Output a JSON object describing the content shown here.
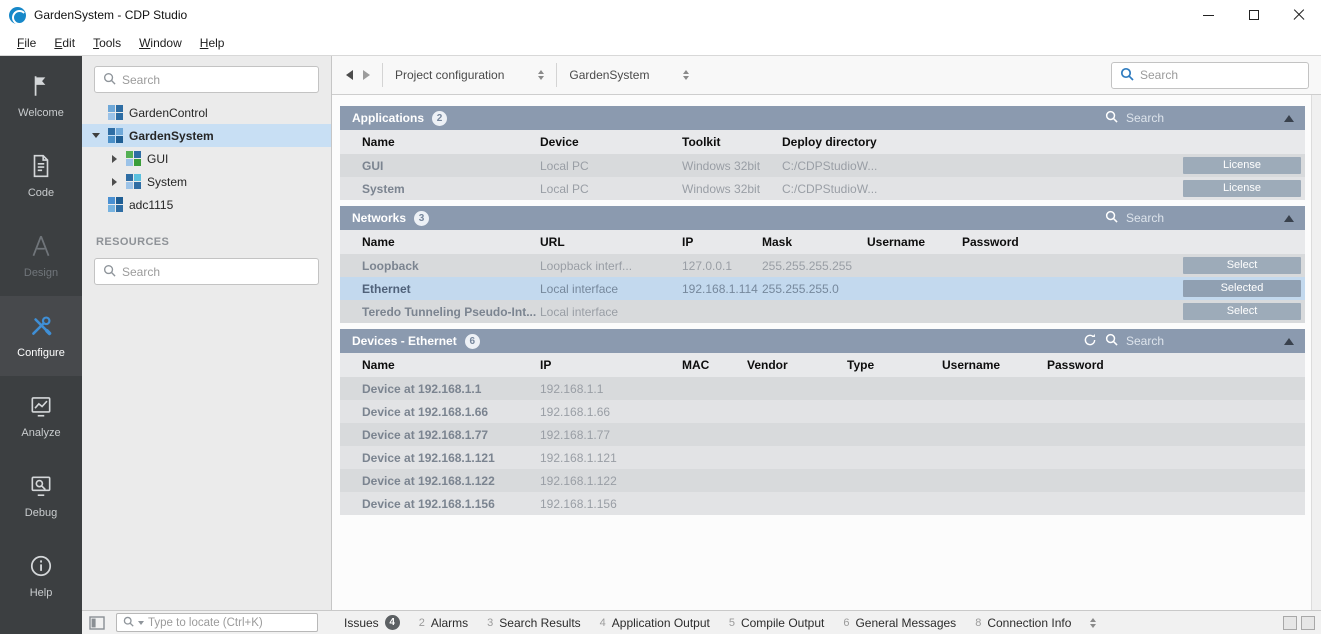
{
  "window": {
    "title": "GardenSystem - CDP Studio"
  },
  "menubar": {
    "items": [
      "File",
      "Edit",
      "Tools",
      "Window",
      "Help"
    ]
  },
  "modebar": {
    "items": [
      {
        "label": "Welcome"
      },
      {
        "label": "Code"
      },
      {
        "label": "Design"
      },
      {
        "label": "Configure"
      },
      {
        "label": "Analyze"
      },
      {
        "label": "Debug"
      },
      {
        "label": "Help"
      }
    ]
  },
  "project_panel": {
    "search_placeholder": "Search",
    "tree": [
      {
        "label": "GardenControl"
      },
      {
        "label": "GardenSystem"
      },
      {
        "label": "GUI"
      },
      {
        "label": "System"
      },
      {
        "label": "adc1115"
      }
    ],
    "resources_label": "RESOURCES",
    "resources_search_placeholder": "Search"
  },
  "toolbar": {
    "breadcrumb": [
      "Project configuration",
      "GardenSystem"
    ],
    "search_placeholder": "Search"
  },
  "sections": {
    "applications": {
      "title": "Applications",
      "count": "2",
      "search_label": "Search",
      "columns": [
        "Name",
        "Device",
        "Toolkit",
        "Deploy directory"
      ],
      "rows": [
        {
          "name": "GUI",
          "device": "Local PC",
          "toolkit": "Windows 32bit",
          "deploy": "C:/CDPStudioW...",
          "action": "License"
        },
        {
          "name": "System",
          "device": "Local PC",
          "toolkit": "Windows 32bit",
          "deploy": "C:/CDPStudioW...",
          "action": "License"
        }
      ]
    },
    "networks": {
      "title": "Networks",
      "count": "3",
      "search_label": "Search",
      "columns": [
        "Name",
        "URL",
        "IP",
        "Mask",
        "Username",
        "Password"
      ],
      "rows": [
        {
          "name": "Loopback",
          "url": "Loopback interf...",
          "ip": "127.0.0.1",
          "mask": "255.255.255.255",
          "username": "",
          "password": "",
          "action": "Select"
        },
        {
          "name": "Ethernet",
          "url": "Local interface",
          "ip": "192.168.1.114",
          "mask": "255.255.255.0",
          "username": "",
          "password": "",
          "action": "Selected"
        },
        {
          "name": "Teredo Tunneling Pseudo-Int...",
          "url": "Local interface",
          "ip": "",
          "mask": "",
          "username": "",
          "password": "",
          "action": "Select"
        }
      ]
    },
    "devices": {
      "title": "Devices - Ethernet",
      "count": "6",
      "search_label": "Search",
      "columns": [
        "Name",
        "IP",
        "MAC",
        "Vendor",
        "Type",
        "Username",
        "Password"
      ],
      "rows": [
        {
          "name": "Device at 192.168.1.1",
          "ip": "192.168.1.1"
        },
        {
          "name": "Device at 192.168.1.66",
          "ip": "192.168.1.66"
        },
        {
          "name": "Device at 192.168.1.77",
          "ip": "192.168.1.77"
        },
        {
          "name": "Device at 192.168.1.121",
          "ip": "192.168.1.121"
        },
        {
          "name": "Device at 192.168.1.122",
          "ip": "192.168.1.122"
        },
        {
          "name": "Device at 192.168.1.156",
          "ip": "192.168.1.156"
        }
      ]
    }
  },
  "statusbar": {
    "locator_placeholder": "Type to locate (Ctrl+K)",
    "tabs": [
      {
        "label": "Issues",
        "badge": "4"
      },
      {
        "num": "2",
        "label": "Alarms"
      },
      {
        "num": "3",
        "label": "Search Results"
      },
      {
        "num": "4",
        "label": "Application Output"
      },
      {
        "num": "5",
        "label": "Compile Output"
      },
      {
        "num": "6",
        "label": "General Messages"
      },
      {
        "num": "8",
        "label": "Connection Info"
      }
    ]
  },
  "colors": {
    "accent_blue": "#2e7bbf",
    "section_header": "#8b9aaf",
    "selection_blue": "#c3d9ee",
    "sidebar_bg": "#3c3f41",
    "button_gray": "#9dabb9"
  }
}
